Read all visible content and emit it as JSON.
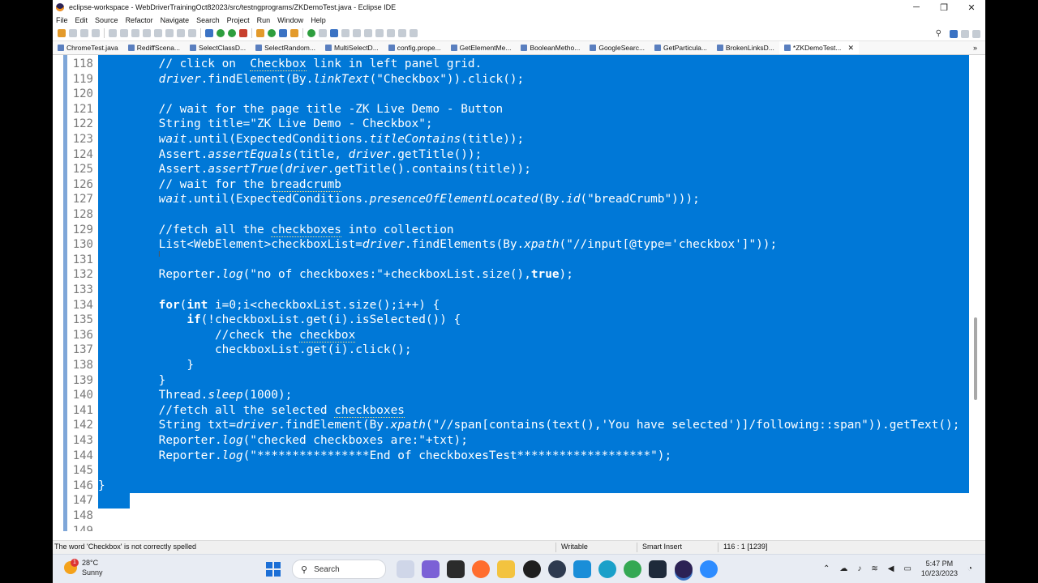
{
  "window": {
    "title": "eclipse-workspace - WebDriverTrainingOct82023/src/testngprograms/ZKDemoTest.java - Eclipse IDE",
    "minimize": "─",
    "maximize": "❐",
    "close": "✕"
  },
  "menu": [
    "File",
    "Edit",
    "Source",
    "Refactor",
    "Navigate",
    "Search",
    "Project",
    "Run",
    "Window",
    "Help"
  ],
  "tabs": [
    {
      "label": "ChromeTest.java"
    },
    {
      "label": "RediffScena..."
    },
    {
      "label": "SelectClassD..."
    },
    {
      "label": "SelectRandom..."
    },
    {
      "label": "MultiSelectD..."
    },
    {
      "label": "config.prope..."
    },
    {
      "label": "GetElementMe..."
    },
    {
      "label": "BooleanMetho..."
    },
    {
      "label": "GoogleSearc..."
    },
    {
      "label": "GetParticula..."
    },
    {
      "label": "BrokenLinksD..."
    },
    {
      "label": "*ZKDemoTest..."
    }
  ],
  "tab_close": "✕",
  "tab_overflow": "»",
  "editor": {
    "line_numbers": [
      "118",
      "119",
      "120",
      "121",
      "122",
      "123",
      "124",
      "125",
      "126",
      "127",
      "128",
      "129",
      "130",
      "131",
      "132",
      "133",
      "134",
      "135",
      "136",
      "137",
      "138",
      "139",
      "140",
      "141",
      "142",
      "143",
      "144",
      "145",
      "146",
      "147",
      "148",
      "149"
    ],
    "selection_color": "#0078d7"
  },
  "statusbar": {
    "message": "The word 'Checkbox' is not correctly spelled",
    "mode": "Writable",
    "insert": "Smart Insert",
    "position": "116 : 1 [1239]"
  },
  "taskbar": {
    "temperature": "28°C",
    "condition": "Sunny",
    "weather_badge": "1",
    "search_label": "Search",
    "time": "5:47 PM",
    "date": "10/23/2023"
  },
  "colors": {
    "accent": "#0078d7",
    "ruler": "#7ea6d8"
  }
}
